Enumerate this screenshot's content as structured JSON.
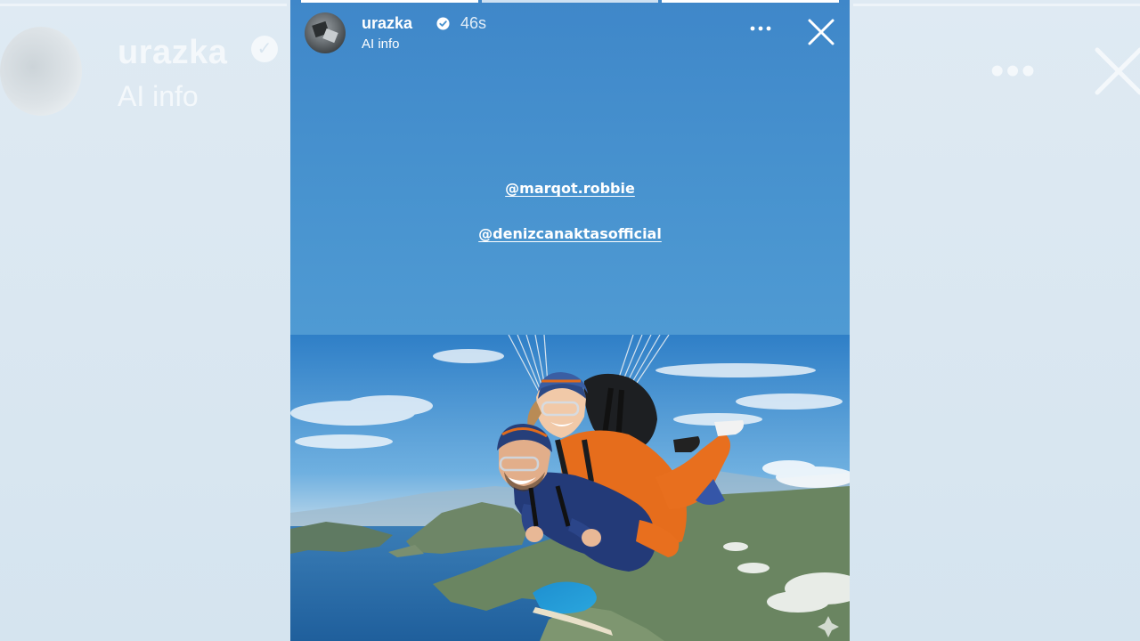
{
  "story": {
    "username": "urazka",
    "timestamp": "46s",
    "ai_label": "AI info",
    "mentions": [
      "@marqot.robbie",
      "@denizcanaktasofficial"
    ],
    "progress": {
      "segments": 3,
      "current_segment": 2,
      "current_fraction": 1.0
    }
  },
  "icons": {
    "verified": "verified-badge-icon",
    "more": "more-options-icon",
    "close": "close-icon"
  },
  "colors": {
    "story_background": "#4a93cf",
    "text": "#ffffff",
    "side_backdrop": "#dbe8f1"
  }
}
